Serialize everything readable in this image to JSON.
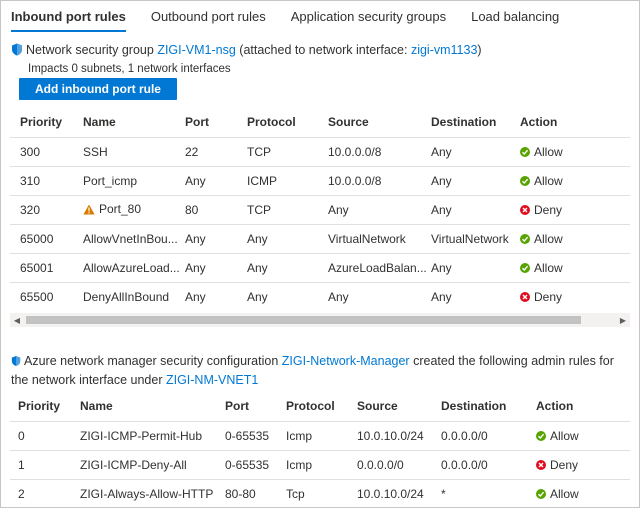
{
  "tabs": [
    "Inbound port rules",
    "Outbound port rules",
    "Application security groups",
    "Load balancing"
  ],
  "nsg": {
    "prefix": "Network security group",
    "nsg_name": "ZIGI-VM1-nsg",
    "middle": "(attached to network interface:",
    "nic_name": "zigi-vm1133",
    "suffix": ")",
    "impacts": "Impacts 0 subnets, 1 network interfaces",
    "add_button": "Add inbound port rule"
  },
  "rules_table": {
    "headers": [
      "Priority",
      "Name",
      "Port",
      "Protocol",
      "Source",
      "Destination",
      "Action"
    ],
    "rows": [
      {
        "priority": "300",
        "name": "SSH",
        "warning": false,
        "port": "22",
        "protocol": "TCP",
        "source": "10.0.0.0/8",
        "destination": "Any",
        "action": "Allow"
      },
      {
        "priority": "310",
        "name": "Port_icmp",
        "warning": false,
        "port": "Any",
        "protocol": "ICMP",
        "source": "10.0.0.0/8",
        "destination": "Any",
        "action": "Allow"
      },
      {
        "priority": "320",
        "name": "Port_80",
        "warning": true,
        "port": "80",
        "protocol": "TCP",
        "source": "Any",
        "destination": "Any",
        "action": "Deny"
      },
      {
        "priority": "65000",
        "name": "AllowVnetInBou...",
        "warning": false,
        "port": "Any",
        "protocol": "Any",
        "source": "VirtualNetwork",
        "destination": "VirtualNetwork",
        "action": "Allow"
      },
      {
        "priority": "65001",
        "name": "AllowAzureLoad...",
        "warning": false,
        "port": "Any",
        "protocol": "Any",
        "source": "AzureLoadBalan...",
        "destination": "Any",
        "action": "Allow"
      },
      {
        "priority": "65500",
        "name": "DenyAllInBound",
        "warning": false,
        "port": "Any",
        "protocol": "Any",
        "source": "Any",
        "destination": "Any",
        "action": "Deny"
      }
    ]
  },
  "anm": {
    "prefix": "Azure network manager security configuration",
    "manager_name": "ZIGI-Network-Manager",
    "middle": "created the following admin rules for the network interface under",
    "vnet_name": "ZIGI-NM-VNET1"
  },
  "admin_table": {
    "headers": [
      "Priority",
      "Name",
      "Port",
      "Protocol",
      "Source",
      "Destination",
      "Action"
    ],
    "rows": [
      {
        "priority": "0",
        "name": "ZIGI-ICMP-Permit-Hub",
        "port": "0-65535",
        "protocol": "Icmp",
        "source": "10.0.10.0/24",
        "destination": "0.0.0.0/0",
        "action": "Allow"
      },
      {
        "priority": "1",
        "name": "ZIGI-ICMP-Deny-All",
        "port": "0-65535",
        "protocol": "Icmp",
        "source": "0.0.0.0/0",
        "destination": "0.0.0.0/0",
        "action": "Deny"
      },
      {
        "priority": "2",
        "name": "ZIGI-Always-Allow-HTTP",
        "port": "80-80",
        "protocol": "Tcp",
        "source": "10.0.10.0/24",
        "destination": "*",
        "action": "Allow"
      }
    ]
  },
  "colors": {
    "accent": "#0078d4",
    "allow": "#57a300",
    "deny": "#e00b1c",
    "warning": "#d87b00"
  }
}
